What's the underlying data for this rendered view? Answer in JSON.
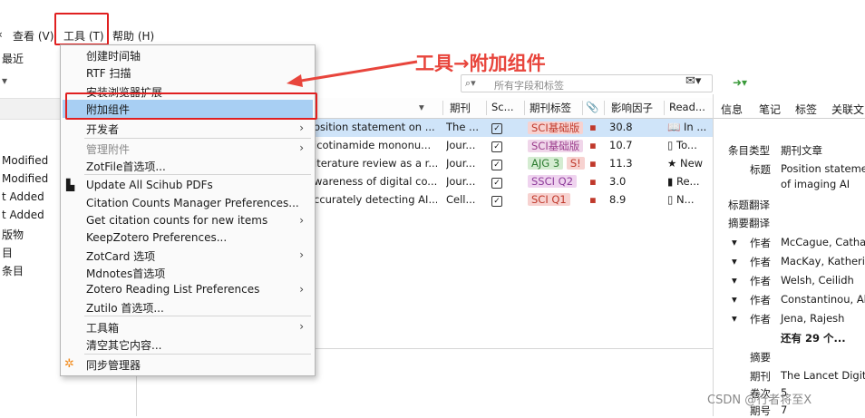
{
  "menubar": {
    "view": "查看 (V)",
    "tools": "工具 (T)",
    "help": "帮助 (H)"
  },
  "left_pane": {
    "recent": "最近",
    "items": [
      "Modified",
      "Modified",
      "t Added",
      "t Added",
      "版物",
      "目",
      "条目"
    ]
  },
  "search": {
    "placeholder": "所有字段和标签"
  },
  "columns": {
    "journal": "期刊",
    "sc": "Sc...",
    "journal_tag": "期刊标签",
    "impact": "影响因子",
    "read": "Read..."
  },
  "rows": [
    {
      "title": "osition statement on ...",
      "journal": "The ...",
      "tag": "SCI基础版",
      "impact": "30.8",
      "read": "In ..."
    },
    {
      "title": "icotinamide mononu...",
      "journal": "Jour...",
      "tag": "SCI基础版",
      "impact": "10.7",
      "read": "To..."
    },
    {
      "title": "iterature review as a r...",
      "journal": "Jour...",
      "tag": "AJG 3",
      "tag2": "S!",
      "impact": "11.3",
      "read": "New"
    },
    {
      "title": "wareness of digital co...",
      "journal": "Jour...",
      "tag": "SSCI Q2",
      "impact": "3.0",
      "read": "Re..."
    },
    {
      "title": "ccurately detecting AI...",
      "journal": "Cell...",
      "tag": "SCI Q1",
      "impact": "8.9",
      "read": "N..."
    }
  ],
  "right_pane": {
    "tabs": [
      "信息",
      "笔记",
      "标签",
      "关联文"
    ],
    "item_type_label": "条目类型",
    "item_type": "期刊文章",
    "title_label": "标题",
    "title_l1": "Position stateme",
    "title_l2": "of imaging AI",
    "title_trans": "标题翻译",
    "abstract_trans": "摘要翻译",
    "author_label": "作者",
    "authors": [
      "McCague, Catha",
      "MacKay, Katheri",
      "Welsh, Ceilidh",
      "Constantinou, Al",
      "Jena, Rajesh"
    ],
    "more": "还有 29 个...",
    "abstract_label": "摘要",
    "pub_label": "期刊",
    "pub": "The Lancet Digit",
    "vol_label": "卷次",
    "vol": "5",
    "issue_label": "期号",
    "issue": "7"
  },
  "menu": {
    "items": [
      {
        "label": "创建时间轴"
      },
      {
        "label": "RTF 扫描"
      },
      {
        "label": "安装浏览器扩展"
      },
      {
        "label": "附加组件"
      },
      {
        "label": "开发者"
      },
      {
        "label": "管理附件"
      },
      {
        "label": "ZotFile首选项..."
      },
      {
        "label": "Update All Scihub PDFs"
      },
      {
        "label": "Citation Counts Manager Preferences..."
      },
      {
        "label": "Get citation counts for new items"
      },
      {
        "label": "KeepZotero Preferences..."
      },
      {
        "label": "ZotCard 选项"
      },
      {
        "label": "Mdnotes首选项"
      },
      {
        "label": "Zotero Reading List Preferences"
      },
      {
        "label": "Zutilo 首选项..."
      },
      {
        "label": "工具箱"
      },
      {
        "label": "清空其它内容..."
      },
      {
        "label": "同步管理器"
      }
    ]
  },
  "annotation": "工具→附加组件",
  "watermark": "CSDN @行者将至X",
  "colors": {
    "highlight": "#a8cff3",
    "annotation_red": "#e8453c",
    "selected_row": "#cfe4f9"
  }
}
